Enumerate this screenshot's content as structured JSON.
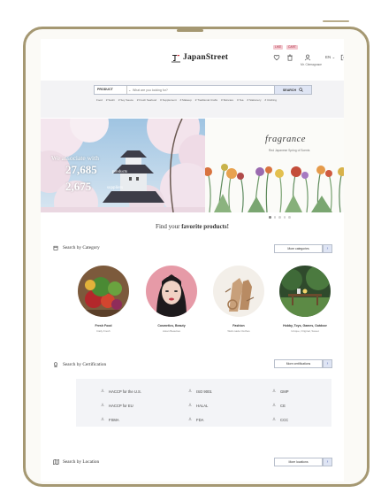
{
  "header": {
    "logo": "JapanStreet",
    "badge_1": "LIKE",
    "badge_2": "CART",
    "user_name": "Mr. Clemagnace",
    "lang": "EN",
    "lang_caret": "⌄",
    "icons": [
      "heart-icon",
      "trash-icon",
      "user-icon",
      "logout-icon"
    ]
  },
  "search": {
    "select_label": "PRODUCT",
    "select_caret": "⌄",
    "placeholder": "What are you looking for?",
    "button_label": "SEARCH",
    "categories": [
      "Food",
      "# Sushi",
      "# Soy Sauce",
      "# Fresh Seafood",
      "# Supplement",
      "# Makeup",
      "# Traditional Crafts",
      "# Skincare",
      "# Tea",
      "# Stationery",
      "# Clothing"
    ]
  },
  "hero": {
    "line1": "We associate with",
    "products_count": "27,685",
    "products_word": "products",
    "suppliers_count": "2,675",
    "suppliers_word": "suppliers",
    "right_title": "fragrance",
    "right_subtitle": "Red Japanese Spring of Scents"
  },
  "find": {
    "prefix": "Find your",
    "emphasis": "favorite products!"
  },
  "category_section": {
    "title": "Search by Category",
    "more": "More categories",
    "arrow": "›",
    "items": [
      {
        "name": "Fresh Food",
        "sub": "Daily Fresh"
      },
      {
        "name": "Cosmetics, Beauty",
        "sub": "Asian Beauties"
      },
      {
        "name": "Fashion",
        "sub": "Well-made Clothes"
      },
      {
        "name": "Hobby, Toys, Games, Outdoor",
        "sub": "Unique, Original, Sweet"
      }
    ]
  },
  "cert_section": {
    "title": "Search by Certification",
    "more": "More certifications",
    "arrow": "›",
    "items": [
      "HACCP for the U.S.",
      "ISO 9001",
      "GMP",
      "HACCP for EU",
      "HALAL",
      "CE",
      "FSMA",
      "FDA",
      "CCC"
    ]
  },
  "location_section": {
    "title": "Search by Location",
    "more": "More locations",
    "arrow": "›"
  }
}
